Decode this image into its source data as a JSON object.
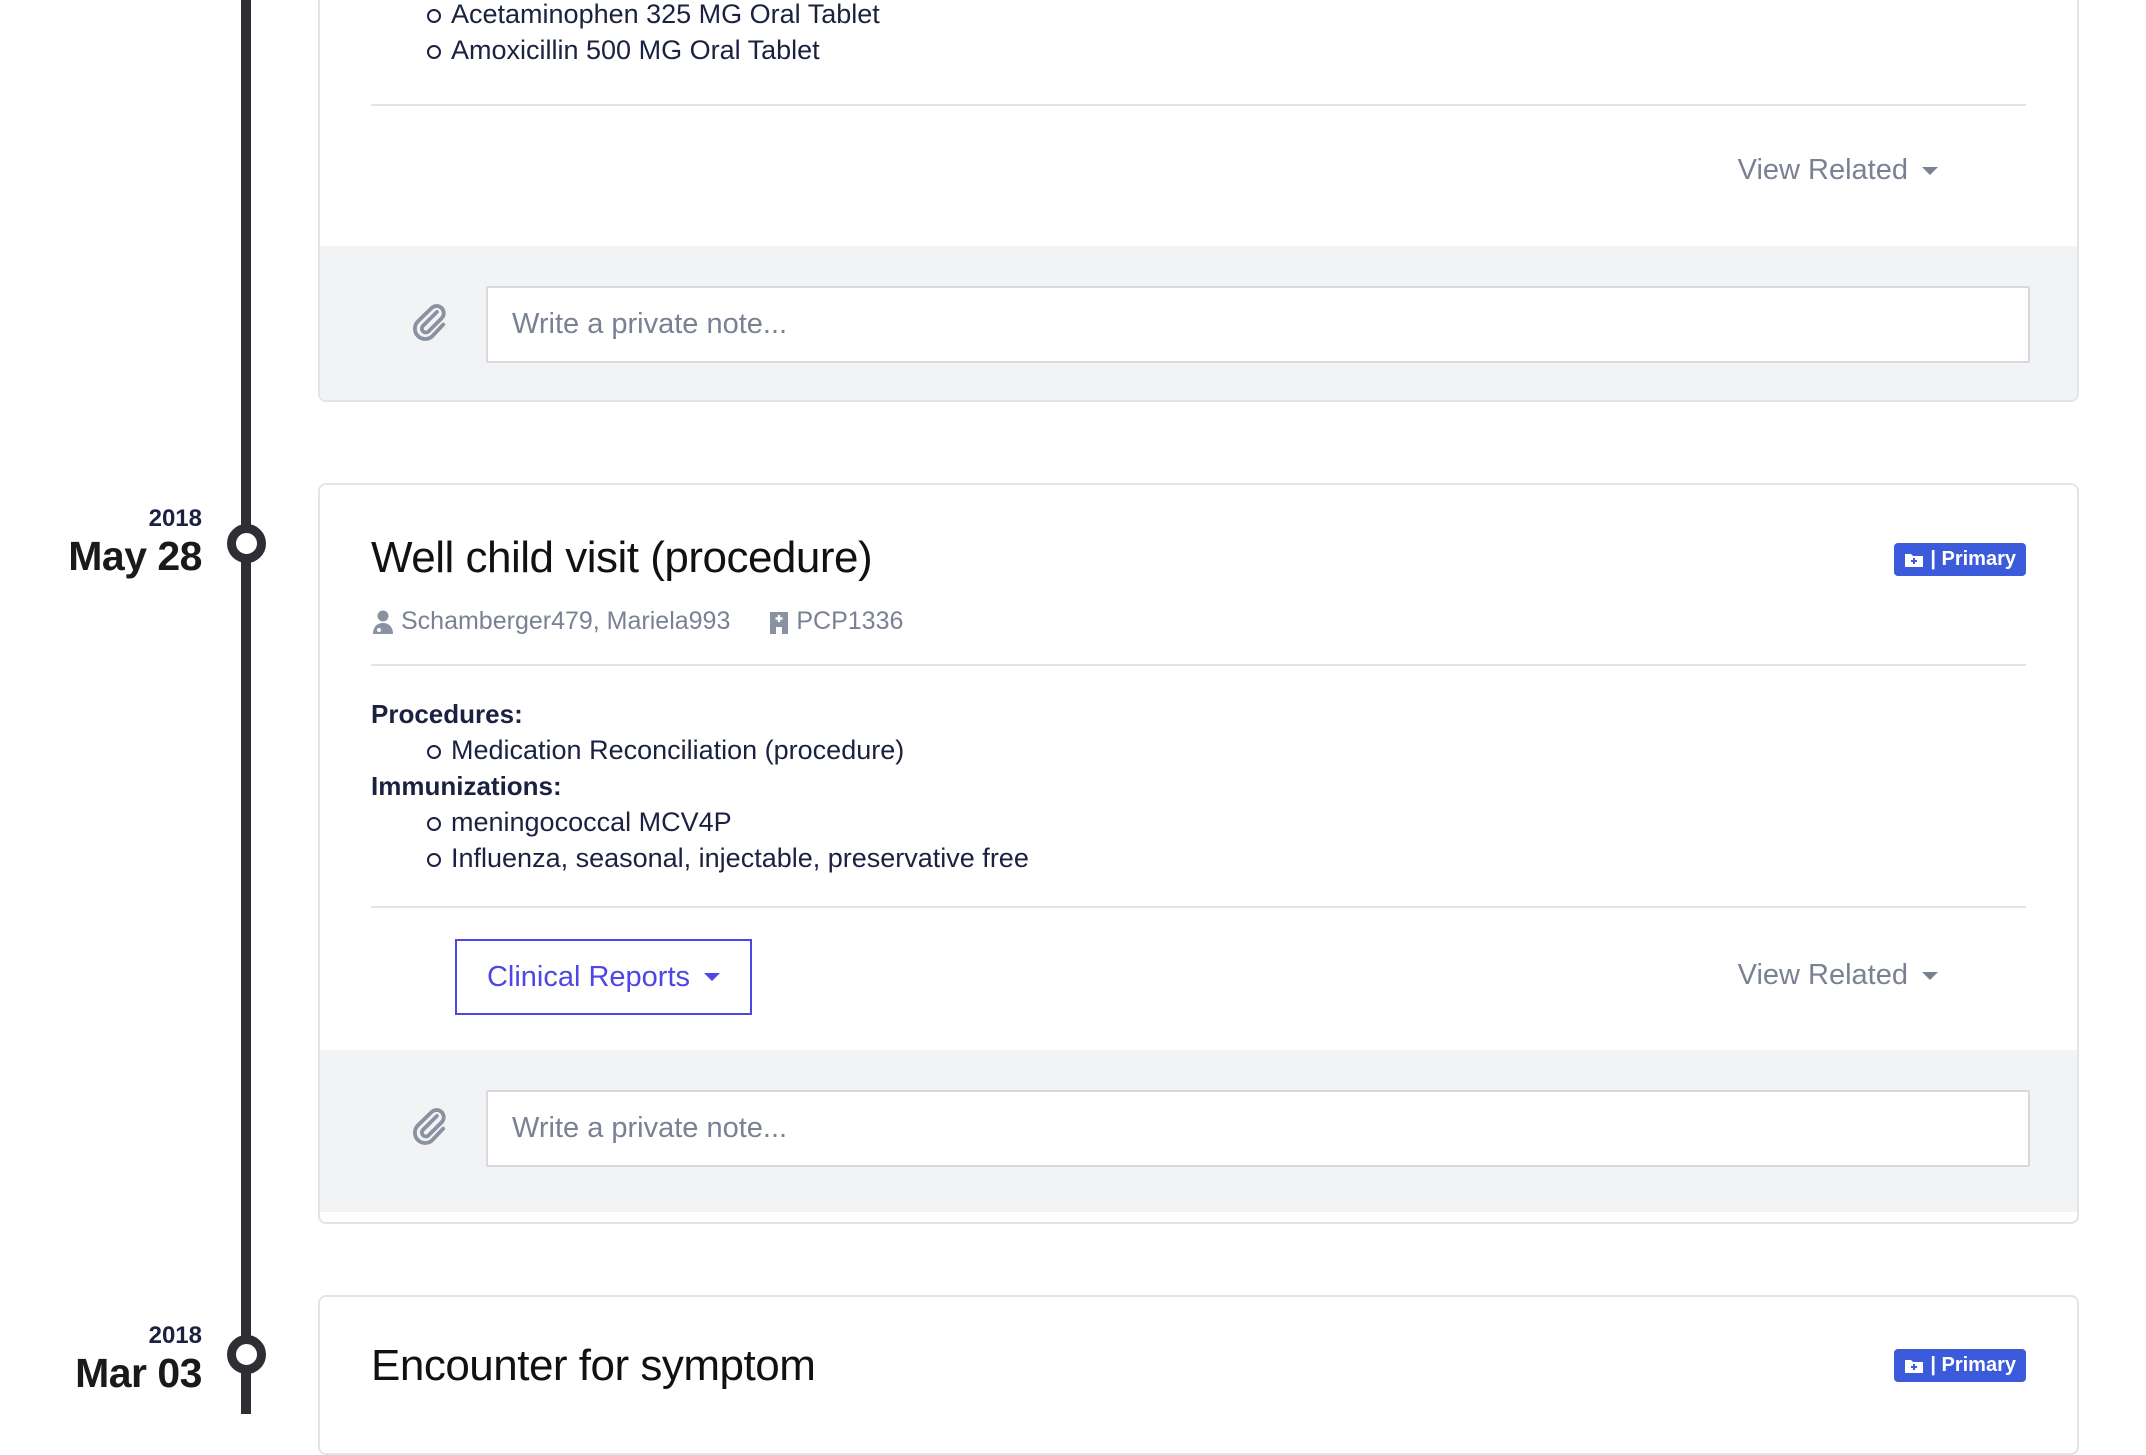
{
  "prev_card": {
    "items": [
      "Acetaminophen 325 MG Oral Tablet",
      "Amoxicillin 500 MG Oral Tablet"
    ],
    "view_related": "View Related",
    "note_placeholder": "Write a private note..."
  },
  "entry1": {
    "year": "2018",
    "day": "May 28",
    "title": "Well child visit (procedure)",
    "badge": "| Primary",
    "practitioner": "Schamberger479, Mariela993",
    "organization": "PCP1336",
    "sections": [
      {
        "label": "Procedures:",
        "items": [
          "Medication Reconciliation (procedure)"
        ]
      },
      {
        "label": "Immunizations:",
        "items": [
          "meningococcal MCV4P",
          "Influenza, seasonal, injectable, preservative free"
        ]
      }
    ],
    "clinical_reports": "Clinical Reports",
    "view_related": "View Related",
    "note_placeholder": "Write a private note..."
  },
  "entry2": {
    "year": "2018",
    "day": "Mar 03",
    "title": "Encounter for symptom",
    "badge": "| Primary"
  },
  "colors": {
    "badge": "#3b5bdb",
    "clinical_button": "#4f46e5",
    "timeline": "#2e2f35"
  }
}
